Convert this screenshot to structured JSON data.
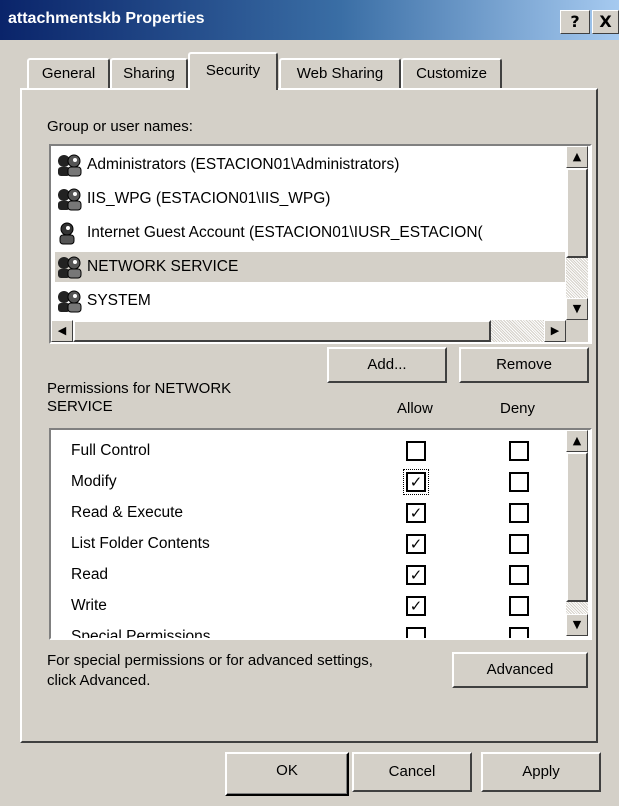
{
  "window": {
    "title": "attachmentskb Properties",
    "help_label": "?",
    "close_label": "X"
  },
  "tabs": [
    {
      "label": "General",
      "active": false
    },
    {
      "label": "Sharing",
      "active": false
    },
    {
      "label": "Security",
      "active": true
    },
    {
      "label": "Web Sharing",
      "active": false
    },
    {
      "label": "Customize",
      "active": false
    }
  ],
  "security": {
    "group_label": "Group or user names:",
    "users": [
      {
        "name": "Administrators (ESTACION01\\Administrators)",
        "icon": "group-icon",
        "selected": false
      },
      {
        "name": "IIS_WPG (ESTACION01\\IIS_WPG)",
        "icon": "group-icon",
        "selected": false
      },
      {
        "name": "Internet Guest Account (ESTACION01\\IUSR_ESTACION(",
        "icon": "user-icon",
        "selected": false
      },
      {
        "name": "NETWORK SERVICE",
        "icon": "group-icon",
        "selected": true
      },
      {
        "name": "SYSTEM",
        "icon": "group-icon",
        "selected": false
      }
    ],
    "add_label": "Add...",
    "remove_label": "Remove",
    "permissions_label_line1": "Permissions for NETWORK",
    "permissions_label_line2": "SERVICE",
    "allow_header": "Allow",
    "deny_header": "Deny",
    "permissions": [
      {
        "name": "Full Control",
        "allow": false,
        "deny": false
      },
      {
        "name": "Modify",
        "allow": true,
        "deny": false
      },
      {
        "name": "Read & Execute",
        "allow": true,
        "deny": false
      },
      {
        "name": "List Folder Contents",
        "allow": true,
        "deny": false
      },
      {
        "name": "Read",
        "allow": true,
        "deny": false
      },
      {
        "name": "Write",
        "allow": true,
        "deny": false
      },
      {
        "name": "Special Permissions",
        "allow": false,
        "deny": false
      }
    ],
    "advanced_text_line1": "For special permissions or for advanced settings,",
    "advanced_text_line2": "click Advanced.",
    "advanced_label": "Advanced"
  },
  "footer": {
    "ok_label": "OK",
    "cancel_label": "Cancel",
    "apply_label": "Apply"
  },
  "colors": {
    "title_start": "#0a246a",
    "title_end": "#a6caf0",
    "face": "#d4d0c8"
  }
}
